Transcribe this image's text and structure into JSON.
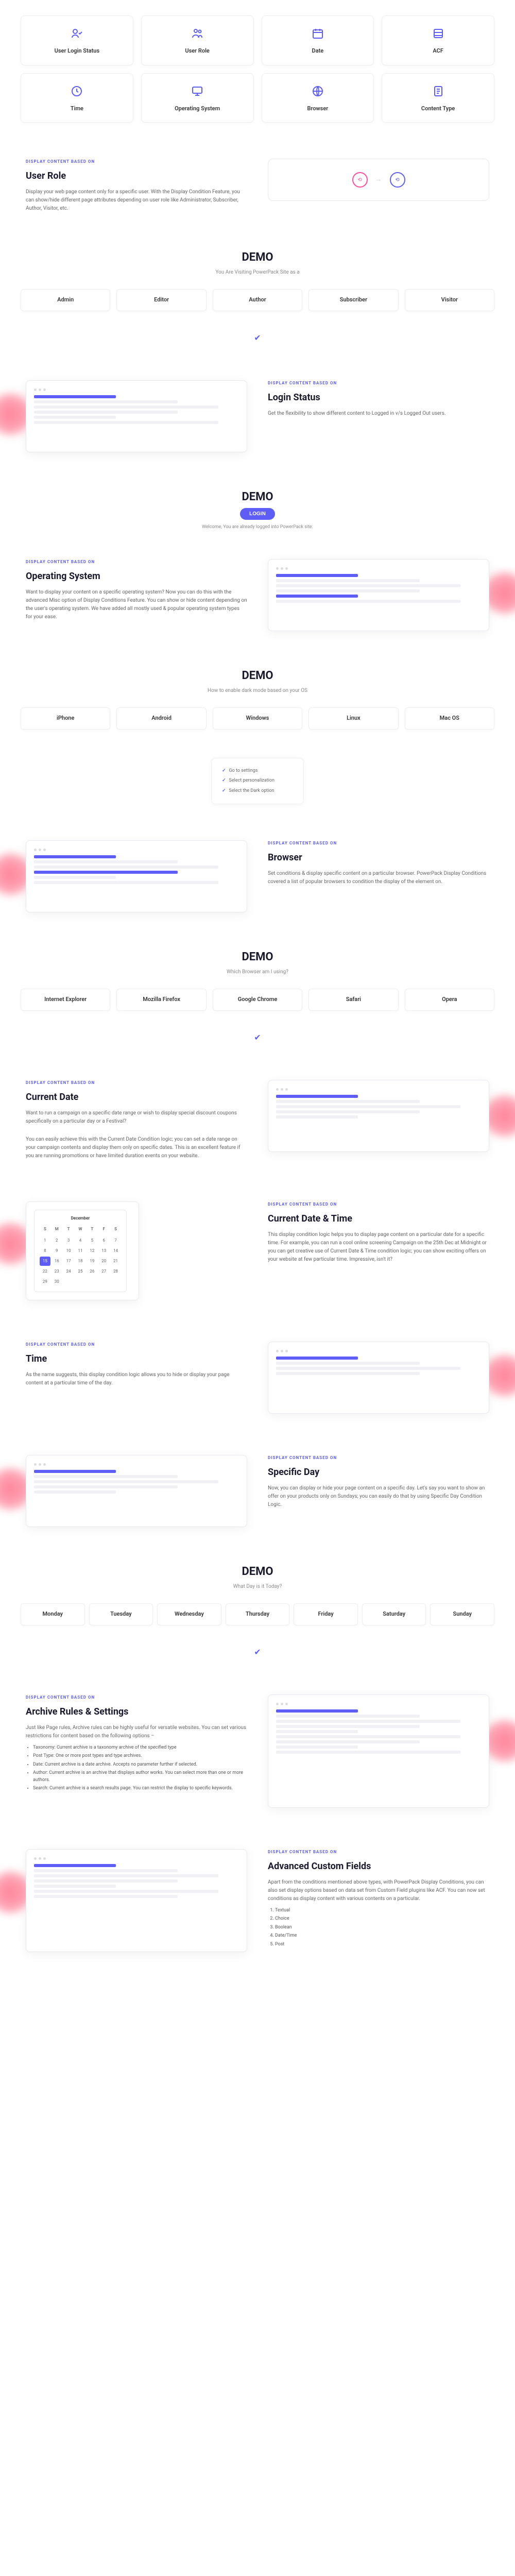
{
  "iconCards": [
    {
      "label": "User Login Status",
      "icon": "user-check"
    },
    {
      "label": "User Role",
      "icon": "users"
    },
    {
      "label": "Date",
      "icon": "calendar"
    },
    {
      "label": "ACF",
      "icon": "database"
    },
    {
      "label": "Time",
      "icon": "clock"
    },
    {
      "label": "Operating System",
      "icon": "monitor"
    },
    {
      "label": "Browser",
      "icon": "globe"
    },
    {
      "label": "Content Type",
      "icon": "file"
    }
  ],
  "userRole": {
    "eyebrow": "DISPLAY CONTENT BASED ON",
    "title": "User Role",
    "desc": "Display your web page content only for a specific user. With the Display Condition Feature, you can show/hide different page attributes depending on user role like Administrator, Subscriber, Author, Visitor, etc."
  },
  "userRoleDemo": {
    "title": "DEMO",
    "sub": "You Are Visiting PowerPack Site as a",
    "tabs": [
      "Admin",
      "Editor",
      "Author",
      "Subscriber",
      "Visitor"
    ]
  },
  "loginStatus": {
    "eyebrow": "DISPLAY CONTENT BASED ON",
    "title": "Login Status",
    "desc": "Get the flexibility to show different content to Logged in v/s Logged Out users."
  },
  "loginDemo": {
    "title": "DEMO",
    "button": "LOGIN",
    "note": "Welcome, You are already logged into PowerPack site."
  },
  "os": {
    "eyebrow": "DISPLAY CONTENT BASED ON",
    "title": "Operating System",
    "desc": "Want to display your content on a specific operating system? Now you can do this with the advanced Misc option of Display Conditions Feature. You can show or hide content depending on the user's operating system. We have added all mostly used & popular operating system types for your ease."
  },
  "osDemo": {
    "title": "DEMO",
    "sub": "How to enable dark mode based on your OS",
    "tabs": [
      "iPhone",
      "Android",
      "Windows",
      "Linux",
      "Mac OS"
    ],
    "checklist": [
      "Go to settings",
      "Select personalization",
      "Select the Dark option"
    ]
  },
  "browser": {
    "eyebrow": "DISPLAY CONTENT BASED ON",
    "title": "Browser",
    "desc": "Set conditions & display specific content on a particular browser. PowerPack Display Conditions covered a list of popular browsers to condition the display of the element on."
  },
  "browserDemo": {
    "title": "DEMO",
    "sub": "Which Browser am I using?",
    "tabs": [
      "Internet Explorer",
      "Mozilla Firefox",
      "Google Chrome",
      "Safari",
      "Opera"
    ]
  },
  "currentDate": {
    "eyebrow": "DISPLAY CONTENT BASED ON",
    "title": "Current Date",
    "desc": "Want to run a campaign on a specific date range or wish to display special discount coupons specifically on a particular day or a Festival?",
    "desc2": "You can easily achieve this with the Current Date Condition logic; you can set a date range on your campaign contents and display them only on specific dates. This is an excellent feature if you are running promotions or have limited duration events on your website."
  },
  "dateTime": {
    "eyebrow": "DISPLAY CONTENT BASED ON",
    "title": "Current Date & Time",
    "desc": "This display condition logic helps you to display page content on a particular date for a specific time. For example, you can run a cool online screening Campaign on the 25th Dec at Midnight or you can get creative use of Current Date & Time condition logic; you can show exciting offers on your website at few particular time. Impressive, isn't it?"
  },
  "time": {
    "eyebrow": "DISPLAY CONTENT BASED ON",
    "title": "Time",
    "desc": "As the name suggests, this display condition logic allows you to hide or display your page content at a particular time of the day."
  },
  "specificDay": {
    "eyebrow": "DISPLAY CONTENT BASED ON",
    "title": "Specific Day",
    "desc": "Now, you can display or hide your page content on a specific day. Let's say you want to show an offer on your products only on Sundays; you can easily do that by using Specific Day Condition Logic."
  },
  "dayDemo": {
    "title": "DEMO",
    "sub": "What Day is it Today?",
    "tabs": [
      "Monday",
      "Tuesday",
      "Wednesday",
      "Thursday",
      "Friday",
      "Saturday",
      "Sunday"
    ]
  },
  "archive": {
    "eyebrow": "DISPLAY CONTENT BASED ON",
    "title": "Archive Rules & Settings",
    "desc": "Just like Page rules, Archive rules can be highly useful for versatile websites. You can set various restrictions for content based on the following options –",
    "bullets": [
      "Taxonomy: Current archive is a taxonomy archive of the specified type",
      "Post Type: One or more post types and type archives.",
      "Date: Current archive is a date archive. Accepts no parameter further if selected.",
      "Author: Current archive is an archive that displays author works. You can select more than one or more authors.",
      "Search: Current archive is a search results page. You can restrict the display to specific keywords."
    ]
  },
  "acf": {
    "eyebrow": "DISPLAY CONTENT BASED ON",
    "title": "Advanced Custom Fields",
    "desc": "Apart from the conditions mentioned above types, with PowerPack Display Conditions, you can also set display options based on data set from Custom Field plugins like ACF. You can now set conditions as display content with various contents on a particular.",
    "bullets": [
      "Textual",
      "Choice",
      "Boolean",
      "Date/Time",
      "Post"
    ]
  },
  "calDays": [
    "S",
    "M",
    "T",
    "W",
    "T",
    "F",
    "S"
  ],
  "calNums": [
    1,
    2,
    3,
    4,
    5,
    6,
    7,
    8,
    9,
    10,
    11,
    12,
    13,
    14,
    15,
    16,
    17,
    18,
    19,
    20,
    21,
    22,
    23,
    24,
    25,
    26,
    27,
    28,
    29,
    30
  ]
}
